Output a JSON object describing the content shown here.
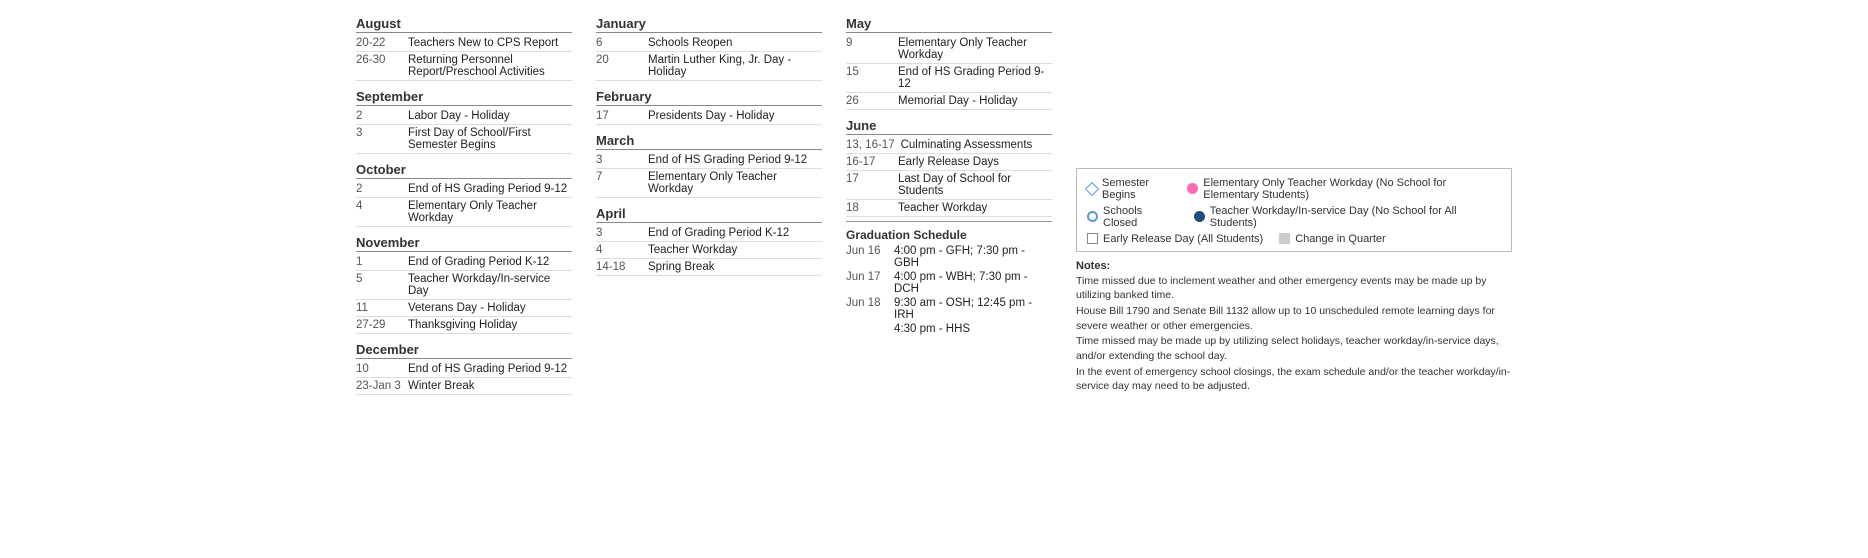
{
  "left": {
    "months": [
      {
        "name": "August",
        "events": [
          {
            "date": "20-22",
            "desc": "Teachers New to CPS Report"
          },
          {
            "date": "26-30",
            "desc": "Returning Personnel Report/Preschool Activities"
          }
        ]
      },
      {
        "name": "September",
        "events": [
          {
            "date": "2",
            "desc": "Labor Day - Holiday"
          },
          {
            "date": "3",
            "desc": "First Day of School/First Semester Begins"
          }
        ]
      },
      {
        "name": "October",
        "events": [
          {
            "date": "2",
            "desc": "End of HS Grading Period 9-12"
          },
          {
            "date": "4",
            "desc": "Elementary Only Teacher Workday"
          }
        ]
      },
      {
        "name": "November",
        "events": [
          {
            "date": "1",
            "desc": "End of Grading Period K-12"
          },
          {
            "date": "5",
            "desc": "Teacher Workday/In-service Day"
          },
          {
            "date": "11",
            "desc": "Veterans Day - Holiday"
          },
          {
            "date": "27-29",
            "desc": "Thanksgiving Holiday"
          }
        ]
      },
      {
        "name": "December",
        "events": [
          {
            "date": "10",
            "desc": "End of HS Grading Period 9-12"
          },
          {
            "date": "23-Jan 3",
            "desc": "Winter Break"
          }
        ]
      }
    ]
  },
  "middle": {
    "months": [
      {
        "name": "January",
        "events": [
          {
            "date": "6",
            "desc": "Schools Reopen"
          },
          {
            "date": "20",
            "desc": "Martin Luther King, Jr. Day - Holiday"
          }
        ]
      },
      {
        "name": "February",
        "events": [
          {
            "date": "17",
            "desc": "Presidents Day - Holiday"
          }
        ]
      },
      {
        "name": "March",
        "events": [
          {
            "date": "3",
            "desc": "End of HS Grading Period 9-12"
          },
          {
            "date": "7",
            "desc": "Elementary Only Teacher Workday"
          }
        ]
      },
      {
        "name": "April",
        "events": [
          {
            "date": "3",
            "desc": "End of Grading Period K-12"
          },
          {
            "date": "4",
            "desc": "Teacher Workday"
          },
          {
            "date": "14-18",
            "desc": "Spring Break"
          }
        ]
      }
    ]
  },
  "right": {
    "months": [
      {
        "name": "May",
        "events": [
          {
            "date": "9",
            "desc": "Elementary Only Teacher Workday"
          },
          {
            "date": "15",
            "desc": "End of HS Grading Period 9-12"
          },
          {
            "date": "26",
            "desc": "Memorial Day - Holiday"
          }
        ]
      },
      {
        "name": "June",
        "events": [
          {
            "date": "13, 16-17",
            "desc": "Culminating Assessments"
          },
          {
            "date": "16-17",
            "desc": "Early Release Days"
          },
          {
            "date": "17",
            "desc": "Last Day of School for Students"
          },
          {
            "date": "18",
            "desc": "Teacher Workday"
          }
        ]
      }
    ],
    "graduation": {
      "title": "Graduation Schedule",
      "entries": [
        {
          "date": "Jun 16",
          "desc": "4:00 pm - GFH; 7:30 pm - GBH"
        },
        {
          "date": "Jun 17",
          "desc": "4:00 pm - WBH; 7:30 pm - DCH"
        },
        {
          "date": "Jun 18",
          "desc": "9:30 am - OSH; 12:45 pm - IRH"
        },
        {
          "date": "",
          "desc": "4:30 pm - HHS"
        }
      ]
    }
  },
  "legend": {
    "items": [
      {
        "icon": "diamond",
        "text": "Semester Begins"
      },
      {
        "icon": "circle-pink",
        "text": "Elementary Only Teacher Workday (No School for Elementary Students)"
      },
      {
        "icon": "circle-blue-outline",
        "text": "Schools Closed"
      },
      {
        "icon": "circle-dark-blue",
        "text": "Teacher Workday/In-service Day (No School for All Students)"
      },
      {
        "icon": "square-outline",
        "text": "Early Release Day (All Students)"
      },
      {
        "icon": "square-gray",
        "text": "Change in Quarter"
      }
    ]
  },
  "notes": {
    "title": "Notes:",
    "lines": [
      "Time missed due to inclement weather and other emergency events may be made up by utilizing banked time.",
      "House Bill 1790 and Senate Bill 1132 allow up to 10 unscheduled remote learning days for severe weather or other emergencies.",
      "Time missed may be made up by utilizing select holidays, teacher workday/in-service days, and/or extending the school day.",
      "In the event of emergency school closings, the exam schedule and/or the teacher workday/in-service day may need to be adjusted."
    ]
  }
}
